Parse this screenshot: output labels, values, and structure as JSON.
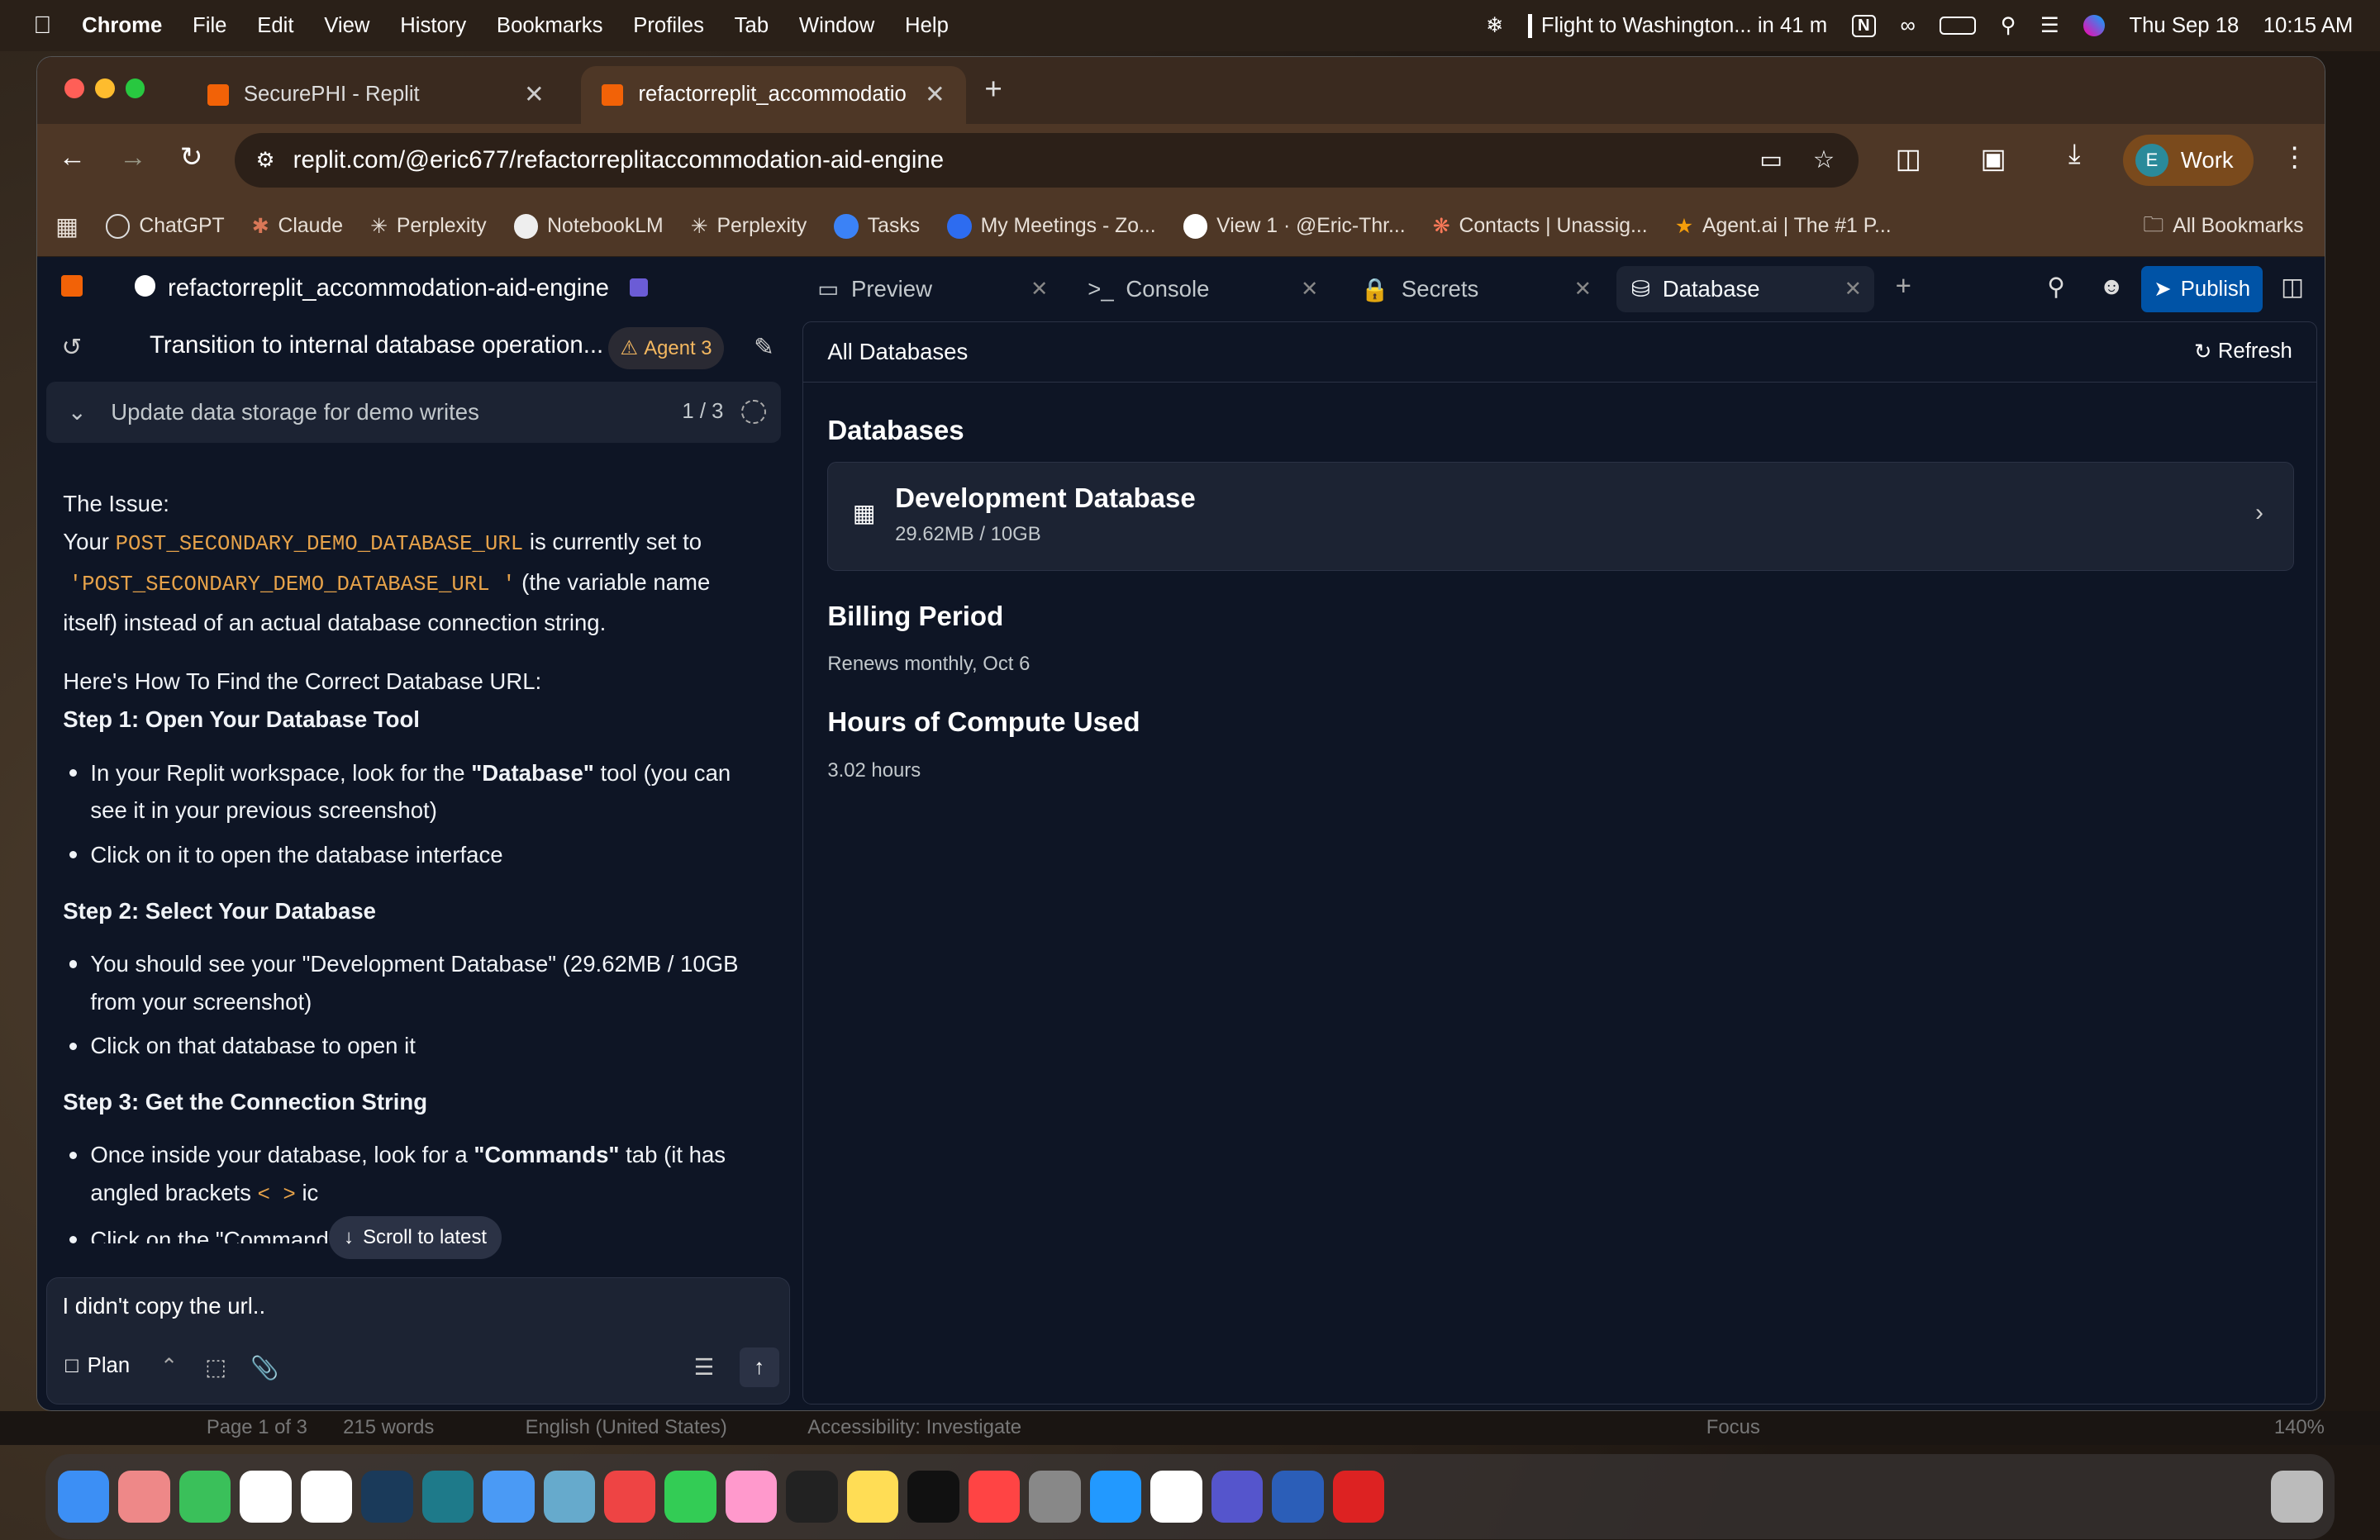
{
  "menubar": {
    "app": "Chrome",
    "items": [
      "File",
      "Edit",
      "View",
      "History",
      "Bookmarks",
      "Profiles",
      "Tab",
      "Window",
      "Help"
    ],
    "flight": "Flight to Washington... in 41 m",
    "date": "Thu Sep 18",
    "time": "10:15 AM"
  },
  "browser": {
    "tabs": [
      {
        "label": "SecurePHI - Replit"
      },
      {
        "label": "refactorreplit_accommodatio"
      }
    ],
    "url": "replit.com/@eric677/refactorreplitaccommodation-aid-engine",
    "profile_initial": "E",
    "profile_label": "Work",
    "bookmarks": [
      "ChatGPT",
      "Claude",
      "Perplexity",
      "NotebookLM",
      "Perplexity",
      "Tasks",
      "My Meetings - Zo...",
      "View 1 · @Eric-Thr...",
      "Contacts | Unassig...",
      "Agent.ai | The #1 P..."
    ],
    "all_bookmarks": "All Bookmarks"
  },
  "replit": {
    "project": "refactorreplit_accommodation-aid-engine",
    "tabs": [
      "Preview",
      "Console",
      "Secrets",
      "Database"
    ],
    "publish": "Publish",
    "thread_title": "Transition to internal database operation...",
    "agent_badge": "Agent 3",
    "task": "Update data storage for demo writes",
    "task_progress": "1 / 3",
    "chat": {
      "issue_heading": "The Issue:",
      "p1a": "Your",
      "var1": "POST_SECONDARY_DEMO_DATABASE_URL",
      "p1b": "is currently set to",
      "var2": "'POST_SECONDARY_DEMO_DATABASE_URL '",
      "p1c": "(the variable name itself) instead of an actual database connection string.",
      "howto": "Here's How To Find the Correct Database URL:",
      "step1": "Step 1: Open Your Database Tool",
      "s1a1": "In your Replit workspace, look for the ",
      "s1ab": "\"Database\"",
      "s1a2": " tool (you can see it in your previous screenshot)",
      "s1b": "Click on it to open the database interface",
      "step2": "Step 2: Select Your Database",
      "s2a": "You should see your \"Development Database\" (29.62MB / 10GB from your screenshot)",
      "s2b": "Click on that database to open it",
      "step3": "Step 3: Get the Connection String",
      "s3a1": "Once inside your database, look for a ",
      "s3ab": "\"Commands\"",
      "s3a2": " tab (it has angled brackets",
      "s3code": "< >",
      "s3a3": "ic",
      "s3b": "Click on the \"Commands\" tab",
      "scroll_latest": "Scroll to latest"
    },
    "input_value": "I didn't copy the url..",
    "plan_label": "Plan",
    "db": {
      "header": "All Databases",
      "refresh": "Refresh",
      "section": "Databases",
      "db_name": "Development Database",
      "db_size": "29.62MB / 10GB",
      "billing_h": "Billing Period",
      "billing_v": "Renews monthly, Oct 6",
      "compute_h": "Hours of Compute Used",
      "compute_v": "3.02 hours"
    }
  },
  "statusbar": {
    "page": "Page 1 of 3",
    "words": "215 words",
    "lang": "English (United States)",
    "access": "Accessibility: Investigate",
    "focus": "Focus",
    "zoom": "140%"
  }
}
